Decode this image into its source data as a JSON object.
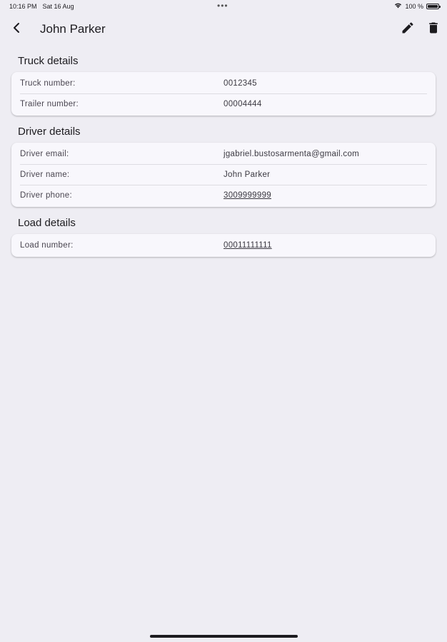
{
  "status_bar": {
    "time": "10:16 PM",
    "date": "Sat 16 Aug",
    "dots": "•••",
    "battery_text": "100 %",
    "battery_level": 1.0,
    "icons": [
      "wifi-icon",
      "battery-icon"
    ]
  },
  "app_bar": {
    "title": "John Parker",
    "icons": [
      "chevron-left-icon",
      "pencil-icon",
      "trash-icon"
    ]
  },
  "sections": [
    {
      "title": "Truck details",
      "rows": [
        {
          "label": "Truck number:",
          "value": "0012345",
          "link": false
        },
        {
          "label": "Trailer number:",
          "value": "00004444",
          "link": false
        }
      ]
    },
    {
      "title": "Driver details",
      "rows": [
        {
          "label": "Driver email:",
          "value": "jgabriel.bustosarmenta@gmail.com",
          "link": false
        },
        {
          "label": "Driver name:",
          "value": "John Parker",
          "link": false
        },
        {
          "label": "Driver phone:",
          "value": "3009999999",
          "link": true
        }
      ]
    },
    {
      "title": "Load details",
      "rows": [
        {
          "label": "Load number:",
          "value": "00011111111",
          "link": true
        }
      ]
    }
  ],
  "colors": {
    "background": "#eeedf3",
    "card": "#f8f7fc",
    "text": "#1c1b1f",
    "label": "#49454f",
    "divider": "#dddce2"
  }
}
